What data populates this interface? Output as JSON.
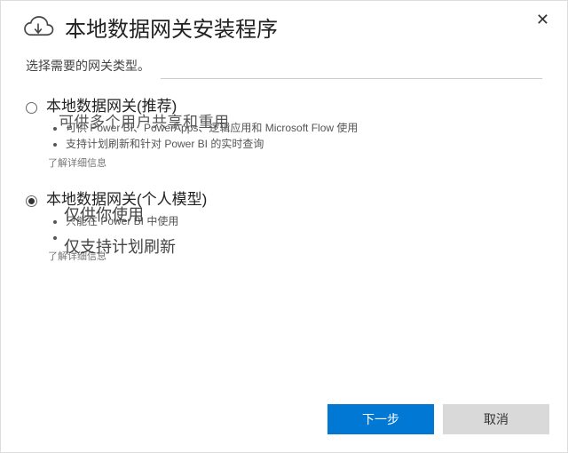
{
  "header": {
    "title": "本地数据网关安装程序",
    "close_symbol": "✕"
  },
  "subtitle": "选择需要的网关类型。",
  "options": [
    {
      "id": "opt-recommended",
      "title": "本地数据网关(推荐)",
      "overlay": "可供多个用户共享和重用",
      "bullets": [
        "可供 Power BI、PowerApps、逻辑应用和 Microsoft  Flow 使用",
        "支持计划刷新和针对 Power BI 的实时查询"
      ],
      "learn_more": "了解详细信息",
      "selected": false
    },
    {
      "id": "opt-personal",
      "title": "本地数据网关(个人模型)",
      "overlay1": "仅供你使用",
      "overlay2": "仅支持计划刷新",
      "bullets": [
        "只能在 Power BI 中使用",
        ""
      ],
      "learn_more": "了解详细信息",
      "selected": true
    }
  ],
  "footer": {
    "next": "下一步",
    "cancel": "取消"
  }
}
